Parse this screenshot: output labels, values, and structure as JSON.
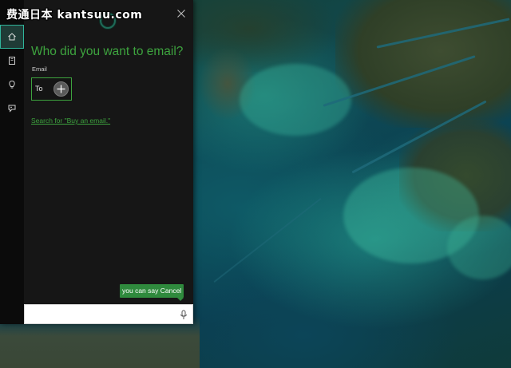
{
  "watermark": {
    "text": "费通日本 kantsuu.com"
  },
  "colors": {
    "accent_green": "#3da33e",
    "tip_green": "#2f8a3d",
    "panel_bg": "#161616",
    "rail_bg": "#0b0b0b",
    "active_rail": "#2fb59b"
  },
  "nav": {
    "items": [
      {
        "icon": "home-icon",
        "active": true
      },
      {
        "icon": "notebook-icon",
        "active": false
      },
      {
        "icon": "reminders-icon",
        "active": false
      },
      {
        "icon": "feedback-icon",
        "active": false
      }
    ]
  },
  "cortana": {
    "question": "Who did you want to email?",
    "email_label": "Email",
    "to_label": "To",
    "search_link": "Search for \"Buy an email.\"",
    "tip": "you can say Cancel"
  },
  "ask_bar": {
    "value": "",
    "placeholder": ""
  }
}
